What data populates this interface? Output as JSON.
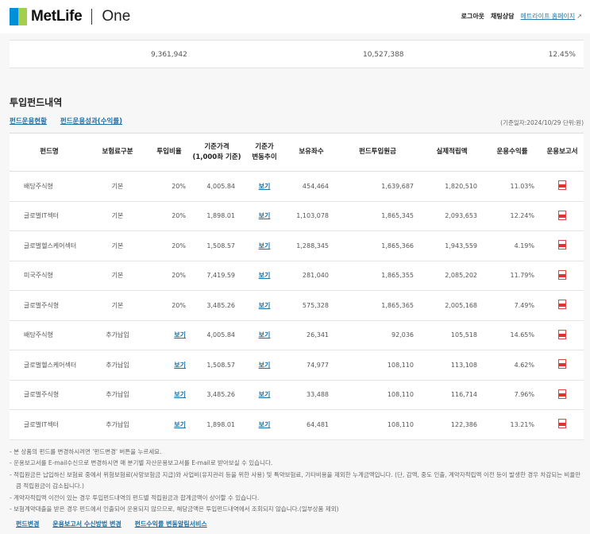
{
  "header": {
    "brand": "MetLife",
    "product": "One",
    "nav": [
      "로그아웃",
      "채팅상담"
    ],
    "home_link": "메트라이프 홈페이지"
  },
  "summary": {
    "values": [
      "9,361,942",
      "10,527,388",
      "12.45%"
    ]
  },
  "section": {
    "title": "투입펀드내역",
    "tabs": [
      "펀드운용현황",
      "펀드운용성과(수익률)"
    ],
    "basis": "(기준일자:2024/10/29 단위:원)"
  },
  "table": {
    "headers": [
      "펀드명",
      "보험료구분",
      "투입비율",
      "기준가격\n(1,000좌 기준)",
      "기준가\n변동추이",
      "보유좌수",
      "펀드투입원금",
      "실제적립액",
      "운용수익률",
      "운용보고서"
    ],
    "view_label": "보기",
    "rows": [
      {
        "fund": "배당주식형",
        "type": "기본",
        "ratio": "20%",
        "price": "4,005.84",
        "units": "454,464",
        "principal": "1,639,687",
        "actual": "1,820,510",
        "yield": "11.03%"
      },
      {
        "fund": "글로벌IT섹터",
        "type": "기본",
        "ratio": "20%",
        "price": "1,898.01",
        "units": "1,103,078",
        "principal": "1,865,345",
        "actual": "2,093,653",
        "yield": "12.24%"
      },
      {
        "fund": "글로벌헬스케어섹터",
        "type": "기본",
        "ratio": "20%",
        "price": "1,508.57",
        "units": "1,288,345",
        "principal": "1,865,366",
        "actual": "1,943,559",
        "yield": "4.19%"
      },
      {
        "fund": "미국주식형",
        "type": "기본",
        "ratio": "20%",
        "price": "7,419.59",
        "units": "281,040",
        "principal": "1,865,355",
        "actual": "2,085,202",
        "yield": "11.79%"
      },
      {
        "fund": "글로벌주식형",
        "type": "기본",
        "ratio": "20%",
        "price": "3,485.26",
        "units": "575,328",
        "principal": "1,865,365",
        "actual": "2,005,168",
        "yield": "7.49%"
      },
      {
        "fund": "배당주식형",
        "type": "추가납입",
        "ratio": null,
        "price": "4,005.84",
        "units": "26,341",
        "principal": "92,036",
        "actual": "105,518",
        "yield": "14.65%"
      },
      {
        "fund": "글로벌헬스케어섹터",
        "type": "추가납입",
        "ratio": null,
        "price": "1,508.57",
        "units": "74,977",
        "principal": "108,110",
        "actual": "113,108",
        "yield": "4.62%"
      },
      {
        "fund": "글로벌주식형",
        "type": "추가납입",
        "ratio": null,
        "price": "3,485.26",
        "units": "33,488",
        "principal": "108,110",
        "actual": "116,714",
        "yield": "7.96%"
      },
      {
        "fund": "글로벌IT섹터",
        "type": "추가납입",
        "ratio": null,
        "price": "1,898.01",
        "units": "64,481",
        "principal": "108,110",
        "actual": "122,386",
        "yield": "13.21%"
      }
    ]
  },
  "notes": [
    "- 본 상품의 펀드를 변경하시려면 '펀드변경' 버튼을 누르세요.",
    "- 운용보고서를 E-mail수신으로 변경하시면 매 분기별 자산운용보고서를 E-mail로 받아보실 수 있습니다.",
    "- 적립원금은 납입하신 보험료 중에서 위험보험료(사망보험금 지급)와 사업비(유지관리 등을 위한 사용) 및 특약보험료, 기타비용을 제외한 누계금액입니다. (단, 감액, 중도 인출, 계약자적립액 이전 등이 발생한 경우 차감되는 비율만큼 적립원금이 감소됩니다.)",
    "- 계약자적립액 이전이 있는 경우 투입펀드내역의 펀드별 적립원금과 합계금액이 상이할 수 있습니다.",
    "- 보험계약대출을 받은 경우 펀드에서 인출되어 운용되지 않으므로, 해당금액은 투입펀드내역에서 조회되지 않습니다.(일부상품 제외)"
  ],
  "bottom_links": [
    "펀드변경",
    "운용보고서 수신방법 변경",
    "펀드수익률 변동알림서비스"
  ],
  "colors": {
    "link": "#1d6fa5",
    "logo_blue": "#0090da",
    "logo_green": "#a4ce4e"
  }
}
